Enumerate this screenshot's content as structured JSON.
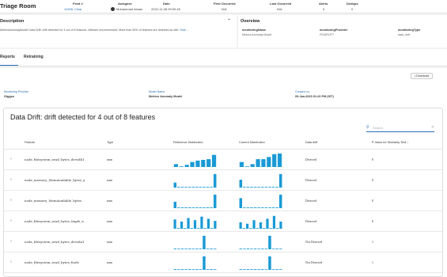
{
  "topbar": {
    "title": "Triage Room",
    "columns": [
      {
        "header": "Feed #",
        "value": "11998: Clear"
      },
      {
        "header": "Assignee",
        "value": "Muhammad Ahsan"
      },
      {
        "header": "Date",
        "value": "2022-11-08 09:00:45"
      },
      {
        "header": "First Occurred",
        "value": "N/A"
      },
      {
        "header": "Last Occurred",
        "value": "N/A"
      },
      {
        "header": "Alerts",
        "value": "0"
      },
      {
        "header": "Dedups",
        "value": "0"
      }
    ]
  },
  "description": {
    "title": "Description",
    "text": "MetricsAnomalyModel Data Drift: drift detected for 4 out of 8 features. Aftessm recommended: More than 50% of features are detected as drift.",
    "more": "Hide..."
  },
  "overview": {
    "title": "Overview",
    "items": [
      {
        "header": "monitoringName",
        "value": "Metrics Anomaly Model"
      },
      {
        "header": "monitoringProvider",
        "value": "FIDDROFT"
      },
      {
        "header": "monitoringType",
        "value": "data_drift"
      }
    ]
  },
  "tabs": [
    "Reports",
    "Retraining"
  ],
  "download_label": "Download",
  "meta": [
    {
      "label": "Monitoring Provider",
      "value": "Giggso"
    },
    {
      "label": "Model Name",
      "value": "Metrics Anomaly Model"
    },
    {
      "label": "Created on",
      "value": "09-Jan-2023 01:20 PM (IST)"
    }
  ],
  "drift": {
    "title": "Data Drift: drift detected for 4 out of 8 features",
    "search_placeholder": "Search",
    "columns": [
      "Feature",
      "Type",
      "Reference Distribution",
      "Current Distribution",
      "Data drift",
      "P-Value for Similarity Test"
    ],
    "sort_icon": "↑",
    "rows": [
      {
        "feature": "node_filesystem_avail_bytes_devsdb1",
        "type": "num",
        "drift": "Detected",
        "pvalue": "0",
        "ref": [
          0.2,
          0.0,
          0.15,
          0.35,
          0.45,
          0.5,
          0.55,
          0.85
        ],
        "cur": [
          0.35,
          0.0,
          0.2,
          0.55,
          0.55,
          0.7,
          0.9,
          0.95
        ]
      },
      {
        "feature": "node_memory_MemAvailable_bytes_y",
        "type": "num",
        "drift": "Detected",
        "pvalue": "0",
        "ref": [
          0.35,
          0.05,
          0.05,
          0.05,
          0.05,
          0.05,
          0.05,
          0.05,
          0.05,
          0.05,
          0.05,
          0.95
        ],
        "cur": [
          0.55,
          0.05,
          0.05,
          0.05,
          0.05,
          0.05,
          0.05,
          0.05,
          0.05,
          0.05,
          0.05,
          0.95
        ]
      },
      {
        "feature": "node_memory_MemAvailable_bytes",
        "type": "num",
        "drift": "Detected",
        "pvalue": "0",
        "ref": [
          0.45,
          0.05,
          0.05,
          0.05,
          0.05,
          0.05,
          0.05,
          0.05,
          0.05,
          0.05,
          0.05,
          0.95
        ],
        "cur": [
          0.7,
          0.05,
          0.05,
          0.05,
          0.05,
          0.05,
          0.05,
          0.05,
          0.05,
          0.05,
          0.05,
          0.95
        ]
      },
      {
        "feature": "node_filesystem_avail_bytes_tmpfs_n",
        "type": "num",
        "drift": "Detected",
        "pvalue": "0",
        "ref": [
          0.65,
          0.05,
          0.5,
          0.05,
          0.75,
          0.05,
          0.6,
          0.05,
          0.85,
          0.05,
          0.7,
          0.05,
          0.55
        ],
        "cur": [
          0.45,
          0.05,
          0.35,
          0.05,
          0.6,
          0.05,
          0.45,
          0.05,
          0.7,
          0.05,
          0.9,
          0.05,
          0.5
        ]
      },
      {
        "feature": "node_filesystem_avail_bytes_devsda1",
        "type": "num",
        "drift": "Not Detected",
        "pvalue": "1",
        "ref": [
          0.05,
          0.0,
          0.05,
          0.0,
          0.05,
          0.0,
          0.05,
          0.0,
          0.95,
          0.0,
          0.05,
          0.0
        ],
        "cur": [
          0.05,
          0.0,
          0.05,
          0.0,
          0.05,
          0.0,
          0.05,
          0.0,
          0.95,
          0.0,
          0.05,
          0.0
        ]
      },
      {
        "feature": "node_filesystem_avail_bytes_fuofs",
        "type": "num",
        "drift": "Not Detected",
        "pvalue": "1",
        "ref": [
          0.05,
          0.0,
          0.05,
          0.0,
          0.05,
          0.0,
          0.05,
          0.0,
          0.95,
          0.0,
          0.05,
          0.0
        ],
        "cur": [
          0.05,
          0.0,
          0.05,
          0.0,
          0.05,
          0.0,
          0.05,
          0.0,
          0.95,
          0.0,
          0.05,
          0.0
        ]
      }
    ]
  },
  "colors": {
    "accent": "#2a6fb5",
    "bar": "#1a9ad6"
  }
}
